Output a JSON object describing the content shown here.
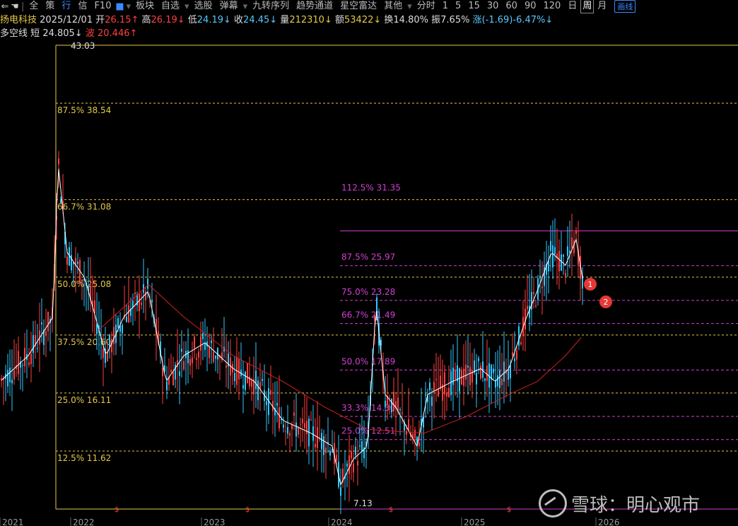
{
  "toolbar": {
    "items": [
      "全",
      "策",
      "行",
      "信",
      "F10",
      "板块",
      "自选",
      "选股",
      "弹幕",
      "九转序列",
      "趋势通道",
      "星空富达",
      "其他"
    ],
    "periods": [
      "分时",
      "1",
      "5",
      "15",
      "30",
      "60",
      "90",
      "120",
      "日",
      "周",
      "月"
    ],
    "selected_period": "周",
    "draw_button": "画线"
  },
  "header": {
    "name": "扬电科技",
    "date": "2025/12/01",
    "open_label": "开",
    "open": "26.15↑",
    "high_label": "高",
    "high": "26.19↓",
    "low_label": "低",
    "low": "24.19↓",
    "close_label": "收",
    "close": "24.45↓",
    "vol_label": "量",
    "vol": "212310↓",
    "amt_label": "额",
    "amt": "53422↓",
    "turnover_label": "换",
    "turnover": "14.80%",
    "amp_label": "振",
    "amp": "7.65%",
    "chg_label": "涨",
    "chg": "(-1.69)-6.47%↓"
  },
  "indicator": {
    "name": "多空线",
    "short_label": "短",
    "short": "24.805↓",
    "wave_label": "波",
    "wave": "20.446↑"
  },
  "colors": {
    "up": "#ff4040",
    "down": "#30c8ff",
    "yellow": "#e6c84a",
    "magenta": "#d040d0",
    "ma_white": "#ffffff",
    "ma_red": "#cc2020"
  },
  "chart_data": {
    "type": "candlestick",
    "price_max_label": "43.03",
    "price_min_label": "7.13",
    "price_range": [
      7.13,
      43.03
    ],
    "fib_left": [
      {
        "label": "87.5%  38.54",
        "price": 38.54
      },
      {
        "label": "66.7%  31.08",
        "price": 31.08
      },
      {
        "label": "50.0%  25.08",
        "price": 25.08
      },
      {
        "label": "37.5%  20.60",
        "price": 20.6
      },
      {
        "label": "25.0%  16.11",
        "price": 16.11
      },
      {
        "label": "12.5%  11.62",
        "price": 11.62
      }
    ],
    "fib_right": [
      {
        "label": "112.5%  31.35",
        "price": 31.35
      },
      {
        "label": "87.5%  25.97",
        "price": 25.97
      },
      {
        "label": "75.0%  23.28",
        "price": 23.28
      },
      {
        "label": "66.7%  21.49",
        "price": 21.49
      },
      {
        "label": "50.0%  17.89",
        "price": 17.89
      },
      {
        "label": "33.3%  14.30",
        "price": 14.3
      },
      {
        "label": "25.0%  12.51",
        "price": 12.51
      }
    ],
    "fib_right_top": 28.66,
    "years": [
      "2021",
      "2022",
      "2023",
      "2024",
      "2025",
      "2026"
    ],
    "markers": [
      "1",
      "2"
    ]
  },
  "watermark": {
    "text": "雪球：明心观市"
  }
}
